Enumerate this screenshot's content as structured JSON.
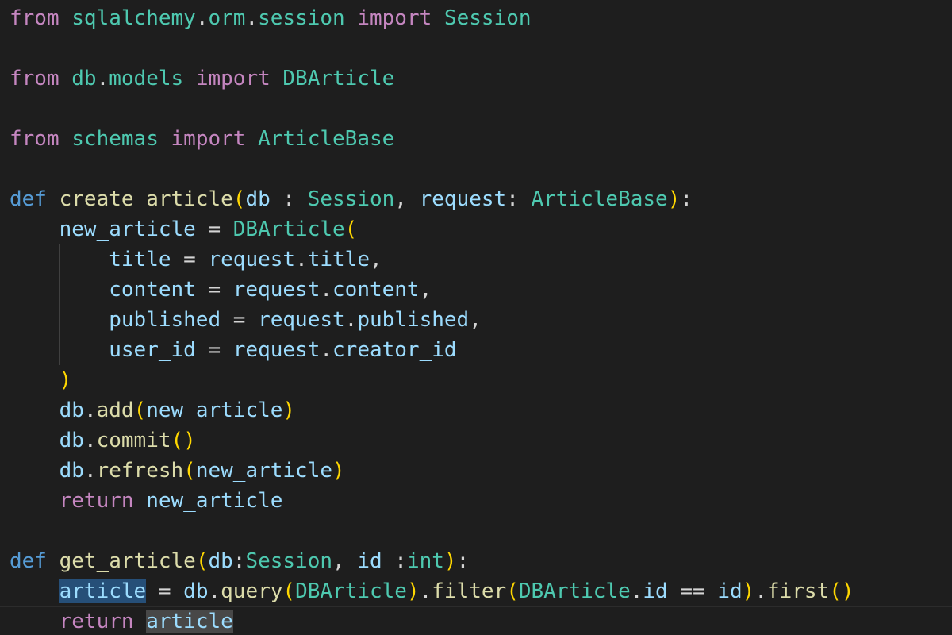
{
  "colors": {
    "background": "#1e1e1e",
    "default": "#d4d4d4",
    "keyword_import": "#c586c0",
    "keyword_def": "#569cd6",
    "module": "#4ec9b0",
    "class": "#4ec9b0",
    "function": "#dcdcaa",
    "variable": "#9cdcfe",
    "bracket_1": "#ffd700",
    "bracket_2": "#da70d6",
    "selection": "#264f78"
  },
  "lines": [
    [
      {
        "t": "from",
        "c": "#c586c0"
      },
      {
        "t": " "
      },
      {
        "t": "sqlalchemy",
        "c": "#4ec9b0"
      },
      {
        "t": "."
      },
      {
        "t": "orm",
        "c": "#4ec9b0"
      },
      {
        "t": "."
      },
      {
        "t": "session",
        "c": "#4ec9b0"
      },
      {
        "t": " "
      },
      {
        "t": "import",
        "c": "#c586c0"
      },
      {
        "t": " "
      },
      {
        "t": "Session",
        "c": "#4ec9b0"
      }
    ],
    [],
    [
      {
        "t": "from",
        "c": "#c586c0"
      },
      {
        "t": " "
      },
      {
        "t": "db",
        "c": "#4ec9b0"
      },
      {
        "t": "."
      },
      {
        "t": "models",
        "c": "#4ec9b0"
      },
      {
        "t": " "
      },
      {
        "t": "import",
        "c": "#c586c0"
      },
      {
        "t": " "
      },
      {
        "t": "DBArticle",
        "c": "#4ec9b0"
      }
    ],
    [],
    [
      {
        "t": "from",
        "c": "#c586c0"
      },
      {
        "t": " "
      },
      {
        "t": "schemas",
        "c": "#4ec9b0"
      },
      {
        "t": " "
      },
      {
        "t": "import",
        "c": "#c586c0"
      },
      {
        "t": " "
      },
      {
        "t": "ArticleBase",
        "c": "#4ec9b0"
      }
    ],
    [],
    [
      {
        "t": "def",
        "c": "#569cd6"
      },
      {
        "t": " "
      },
      {
        "t": "create_article",
        "c": "#dcdcaa"
      },
      {
        "t": "(",
        "c": "#ffd700"
      },
      {
        "t": "db",
        "c": "#9cdcfe"
      },
      {
        "t": " : "
      },
      {
        "t": "Session",
        "c": "#4ec9b0"
      },
      {
        "t": ", "
      },
      {
        "t": "request",
        "c": "#9cdcfe"
      },
      {
        "t": ": "
      },
      {
        "t": "ArticleBase",
        "c": "#4ec9b0"
      },
      {
        "t": ")",
        "c": "#ffd700"
      },
      {
        "t": ":"
      }
    ],
    [
      {
        "t": "    "
      },
      {
        "t": "new_article",
        "c": "#9cdcfe"
      },
      {
        "t": " = "
      },
      {
        "t": "DBArticle",
        "c": "#4ec9b0"
      },
      {
        "t": "(",
        "c": "#ffd700"
      }
    ],
    [
      {
        "t": "        "
      },
      {
        "t": "title",
        "c": "#9cdcfe"
      },
      {
        "t": " = "
      },
      {
        "t": "request",
        "c": "#9cdcfe"
      },
      {
        "t": "."
      },
      {
        "t": "title",
        "c": "#9cdcfe"
      },
      {
        "t": ","
      }
    ],
    [
      {
        "t": "        "
      },
      {
        "t": "content",
        "c": "#9cdcfe"
      },
      {
        "t": " = "
      },
      {
        "t": "request",
        "c": "#9cdcfe"
      },
      {
        "t": "."
      },
      {
        "t": "content",
        "c": "#9cdcfe"
      },
      {
        "t": ","
      }
    ],
    [
      {
        "t": "        "
      },
      {
        "t": "published",
        "c": "#9cdcfe"
      },
      {
        "t": " = "
      },
      {
        "t": "request",
        "c": "#9cdcfe"
      },
      {
        "t": "."
      },
      {
        "t": "published",
        "c": "#9cdcfe"
      },
      {
        "t": ","
      }
    ],
    [
      {
        "t": "        "
      },
      {
        "t": "user_id",
        "c": "#9cdcfe"
      },
      {
        "t": " = "
      },
      {
        "t": "request",
        "c": "#9cdcfe"
      },
      {
        "t": "."
      },
      {
        "t": "creator_id",
        "c": "#9cdcfe"
      }
    ],
    [
      {
        "t": "    "
      },
      {
        "t": ")",
        "c": "#ffd700"
      }
    ],
    [
      {
        "t": "    "
      },
      {
        "t": "db",
        "c": "#9cdcfe"
      },
      {
        "t": "."
      },
      {
        "t": "add",
        "c": "#dcdcaa"
      },
      {
        "t": "(",
        "c": "#ffd700"
      },
      {
        "t": "new_article",
        "c": "#9cdcfe"
      },
      {
        "t": ")",
        "c": "#ffd700"
      }
    ],
    [
      {
        "t": "    "
      },
      {
        "t": "db",
        "c": "#9cdcfe"
      },
      {
        "t": "."
      },
      {
        "t": "commit",
        "c": "#dcdcaa"
      },
      {
        "t": "()",
        "c": "#ffd700"
      }
    ],
    [
      {
        "t": "    "
      },
      {
        "t": "db",
        "c": "#9cdcfe"
      },
      {
        "t": "."
      },
      {
        "t": "refresh",
        "c": "#dcdcaa"
      },
      {
        "t": "(",
        "c": "#ffd700"
      },
      {
        "t": "new_article",
        "c": "#9cdcfe"
      },
      {
        "t": ")",
        "c": "#ffd700"
      }
    ],
    [
      {
        "t": "    "
      },
      {
        "t": "return",
        "c": "#c586c0"
      },
      {
        "t": " "
      },
      {
        "t": "new_article",
        "c": "#9cdcfe"
      }
    ],
    [],
    [
      {
        "t": "def",
        "c": "#569cd6"
      },
      {
        "t": " "
      },
      {
        "t": "get_article",
        "c": "#dcdcaa"
      },
      {
        "t": "(",
        "c": "#ffd700"
      },
      {
        "t": "db",
        "c": "#9cdcfe"
      },
      {
        "t": ":"
      },
      {
        "t": "Session",
        "c": "#4ec9b0"
      },
      {
        "t": ", "
      },
      {
        "t": "id",
        "c": "#9cdcfe"
      },
      {
        "t": " :"
      },
      {
        "t": "int",
        "c": "#4ec9b0"
      },
      {
        "t": ")",
        "c": "#ffd700"
      },
      {
        "t": ":"
      }
    ],
    [
      {
        "t": "    "
      },
      {
        "t": "article",
        "c": "#9cdcfe",
        "hl": "hl-word"
      },
      {
        "t": " = "
      },
      {
        "t": "db",
        "c": "#9cdcfe"
      },
      {
        "t": "."
      },
      {
        "t": "query",
        "c": "#dcdcaa"
      },
      {
        "t": "(",
        "c": "#ffd700"
      },
      {
        "t": "DBArticle",
        "c": "#4ec9b0"
      },
      {
        "t": ")",
        "c": "#ffd700"
      },
      {
        "t": "."
      },
      {
        "t": "filter",
        "c": "#dcdcaa"
      },
      {
        "t": "(",
        "c": "#ffd700"
      },
      {
        "t": "DBArticle",
        "c": "#4ec9b0"
      },
      {
        "t": "."
      },
      {
        "t": "id",
        "c": "#9cdcfe"
      },
      {
        "t": " == "
      },
      {
        "t": "id",
        "c": "#9cdcfe"
      },
      {
        "t": ")",
        "c": "#ffd700"
      },
      {
        "t": "."
      },
      {
        "t": "first",
        "c": "#dcdcaa"
      },
      {
        "t": "()",
        "c": "#ffd700"
      }
    ],
    [
      {
        "t": "    "
      },
      {
        "t": "return",
        "c": "#c586c0"
      },
      {
        "t": " "
      },
      {
        "t": "article",
        "c": "#9cdcfe",
        "hl": "hl-occ"
      }
    ]
  ]
}
